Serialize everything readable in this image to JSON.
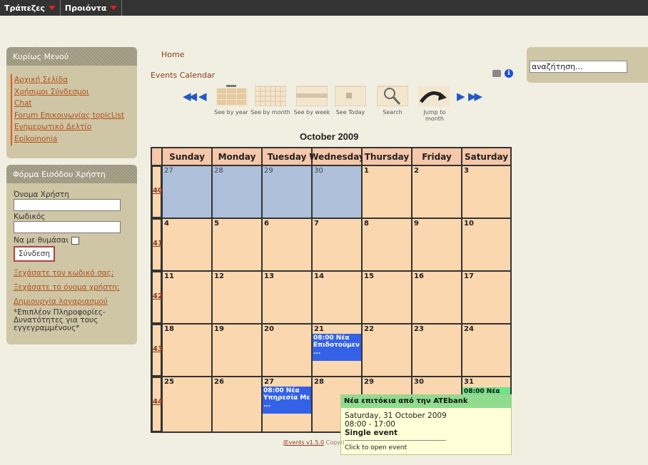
{
  "topmenu": [
    {
      "label": "Τράπεζες"
    },
    {
      "label": "Προιόντα"
    }
  ],
  "main_menu": {
    "title": "Κυρίως Μενού",
    "items": [
      "Αρχική Σελίδα",
      "Χρήσιμοι Σύνδεσμοι",
      "Chat",
      "Forum Επικοινωνίας topicList",
      "Ενημερωτικό Δελτίο",
      "Epikoinonia"
    ]
  },
  "login": {
    "title": "Φόρμα Εισόδου Χρήστη",
    "username_label": "Όνομα Χρήστη",
    "password_label": "Κωδικός",
    "remember_label": "Να με θυμάσαι",
    "submit_label": "Σύνδεση",
    "forgot_password": "Ξεχάσατε τον κωδικό σας;",
    "forgot_username": "Ξεχάσατε το όνομα χρήστη;",
    "create_account": "Δημιουργία λογαριασμού",
    "note": "*Επιπλέον Πληροφορίες-Δυνατότητες για τους εγγεγραμμένους*"
  },
  "breadcrumb": "Home",
  "page_title": "Events Calendar",
  "nav": {
    "see_by_year": "See by year",
    "see_by_month": "See by month",
    "see_by_week": "See by week",
    "see_today": "See Today",
    "search": "Search",
    "jump_to_month": "Jump to month",
    "prev_year": "«",
    "prev_month": "‹",
    "next_month": "›",
    "next_year": "»"
  },
  "calendar": {
    "title": "October 2009",
    "days": [
      "Sunday",
      "Monday",
      "Tuesday",
      "Wednesday",
      "Thursday",
      "Friday",
      "Saturday"
    ],
    "weeks": [
      "40",
      "41",
      "42",
      "43",
      "44"
    ],
    "dates": [
      [
        "27",
        "28",
        "29",
        "30",
        "1",
        "2",
        "3"
      ],
      [
        "4",
        "5",
        "6",
        "7",
        "8",
        "9",
        "10"
      ],
      [
        "11",
        "12",
        "13",
        "14",
        "15",
        "16",
        "17"
      ],
      [
        "18",
        "19",
        "20",
        "21",
        "22",
        "23",
        "24"
      ],
      [
        "25",
        "26",
        "27",
        "28",
        "29",
        "30",
        "31"
      ]
    ],
    "events": {
      "e21": "08:00 Νέα Επιδοτούμεν ...",
      "e27": "08:00 Νέα Υπηρεσία Με ...",
      "e31": "08:00 Νέα τόκια απ ..."
    }
  },
  "tooltip": {
    "title": "Νέα επιτόκια από την ATEbank",
    "date": "Saturday, 31 October 2009",
    "time": "08:00 - 17:00",
    "type": "Single event",
    "action": "Click to open event"
  },
  "footer": {
    "link": "JEvents v1.5.0",
    "text": "Copyri"
  },
  "search": {
    "value": "αναζήτηση..."
  }
}
